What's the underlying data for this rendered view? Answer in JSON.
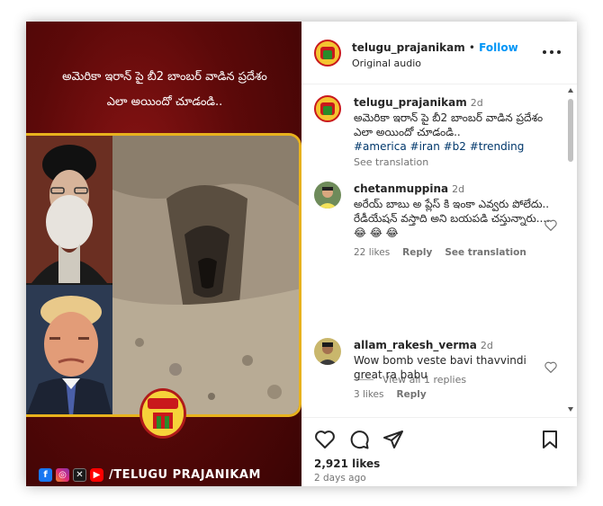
{
  "media": {
    "overlay_caption_line1": "అమెరికా ఇరాన్ పై బీ2 బాంబర్ వాడిన ప్రదేశం",
    "overlay_caption_line2": "ఎలా అయిందో చూడండి..",
    "footer_handle": "/TELUGU PRAJANIKAM",
    "social_icons": [
      "facebook-icon",
      "instagram-icon",
      "x-icon",
      "youtube-icon"
    ],
    "logo_text": "తెలుగు"
  },
  "post_header": {
    "username": "telugu_prajanikam",
    "separator": "•",
    "follow_label": "Follow",
    "audio_label": "Original audio"
  },
  "caption": {
    "username": "telugu_prajanikam",
    "time": "2d",
    "text": "అమెరికా ఇరాన్ పై బీ2 బాంబర్ వాడిన ప్రదేశం ఎలా అయిందో చూడండి..",
    "hashtags": "#america #iran #b2 #trending",
    "see_translation": "See translation"
  },
  "comments": [
    {
      "username": "chetanmuppina",
      "time": "2d",
      "text": "అరేయ్ బాబు అ ప్లేస్ కి ఇంకా ఎవ్వరు పోలేదు.. రేడీయేషన్ వస్తాది అని బయపడి చస్తున్నారు....😂 😂 😂",
      "likes": "22 likes",
      "reply_label": "Reply",
      "see_translation": "See translation",
      "view_replies": "View all 1 replies"
    },
    {
      "username": "allam_rakesh_verma",
      "time": "2d",
      "text": "Wow bomb veste bavi thavvindi great ra babu",
      "likes": "3 likes",
      "reply_label": "Reply"
    }
  ],
  "actions": {
    "likes_count": "2,921 likes",
    "date": "2 days ago"
  },
  "colors": {
    "accent": "#0095f6",
    "media_bg": "#5c0909",
    "media_border": "#e8b21d"
  }
}
